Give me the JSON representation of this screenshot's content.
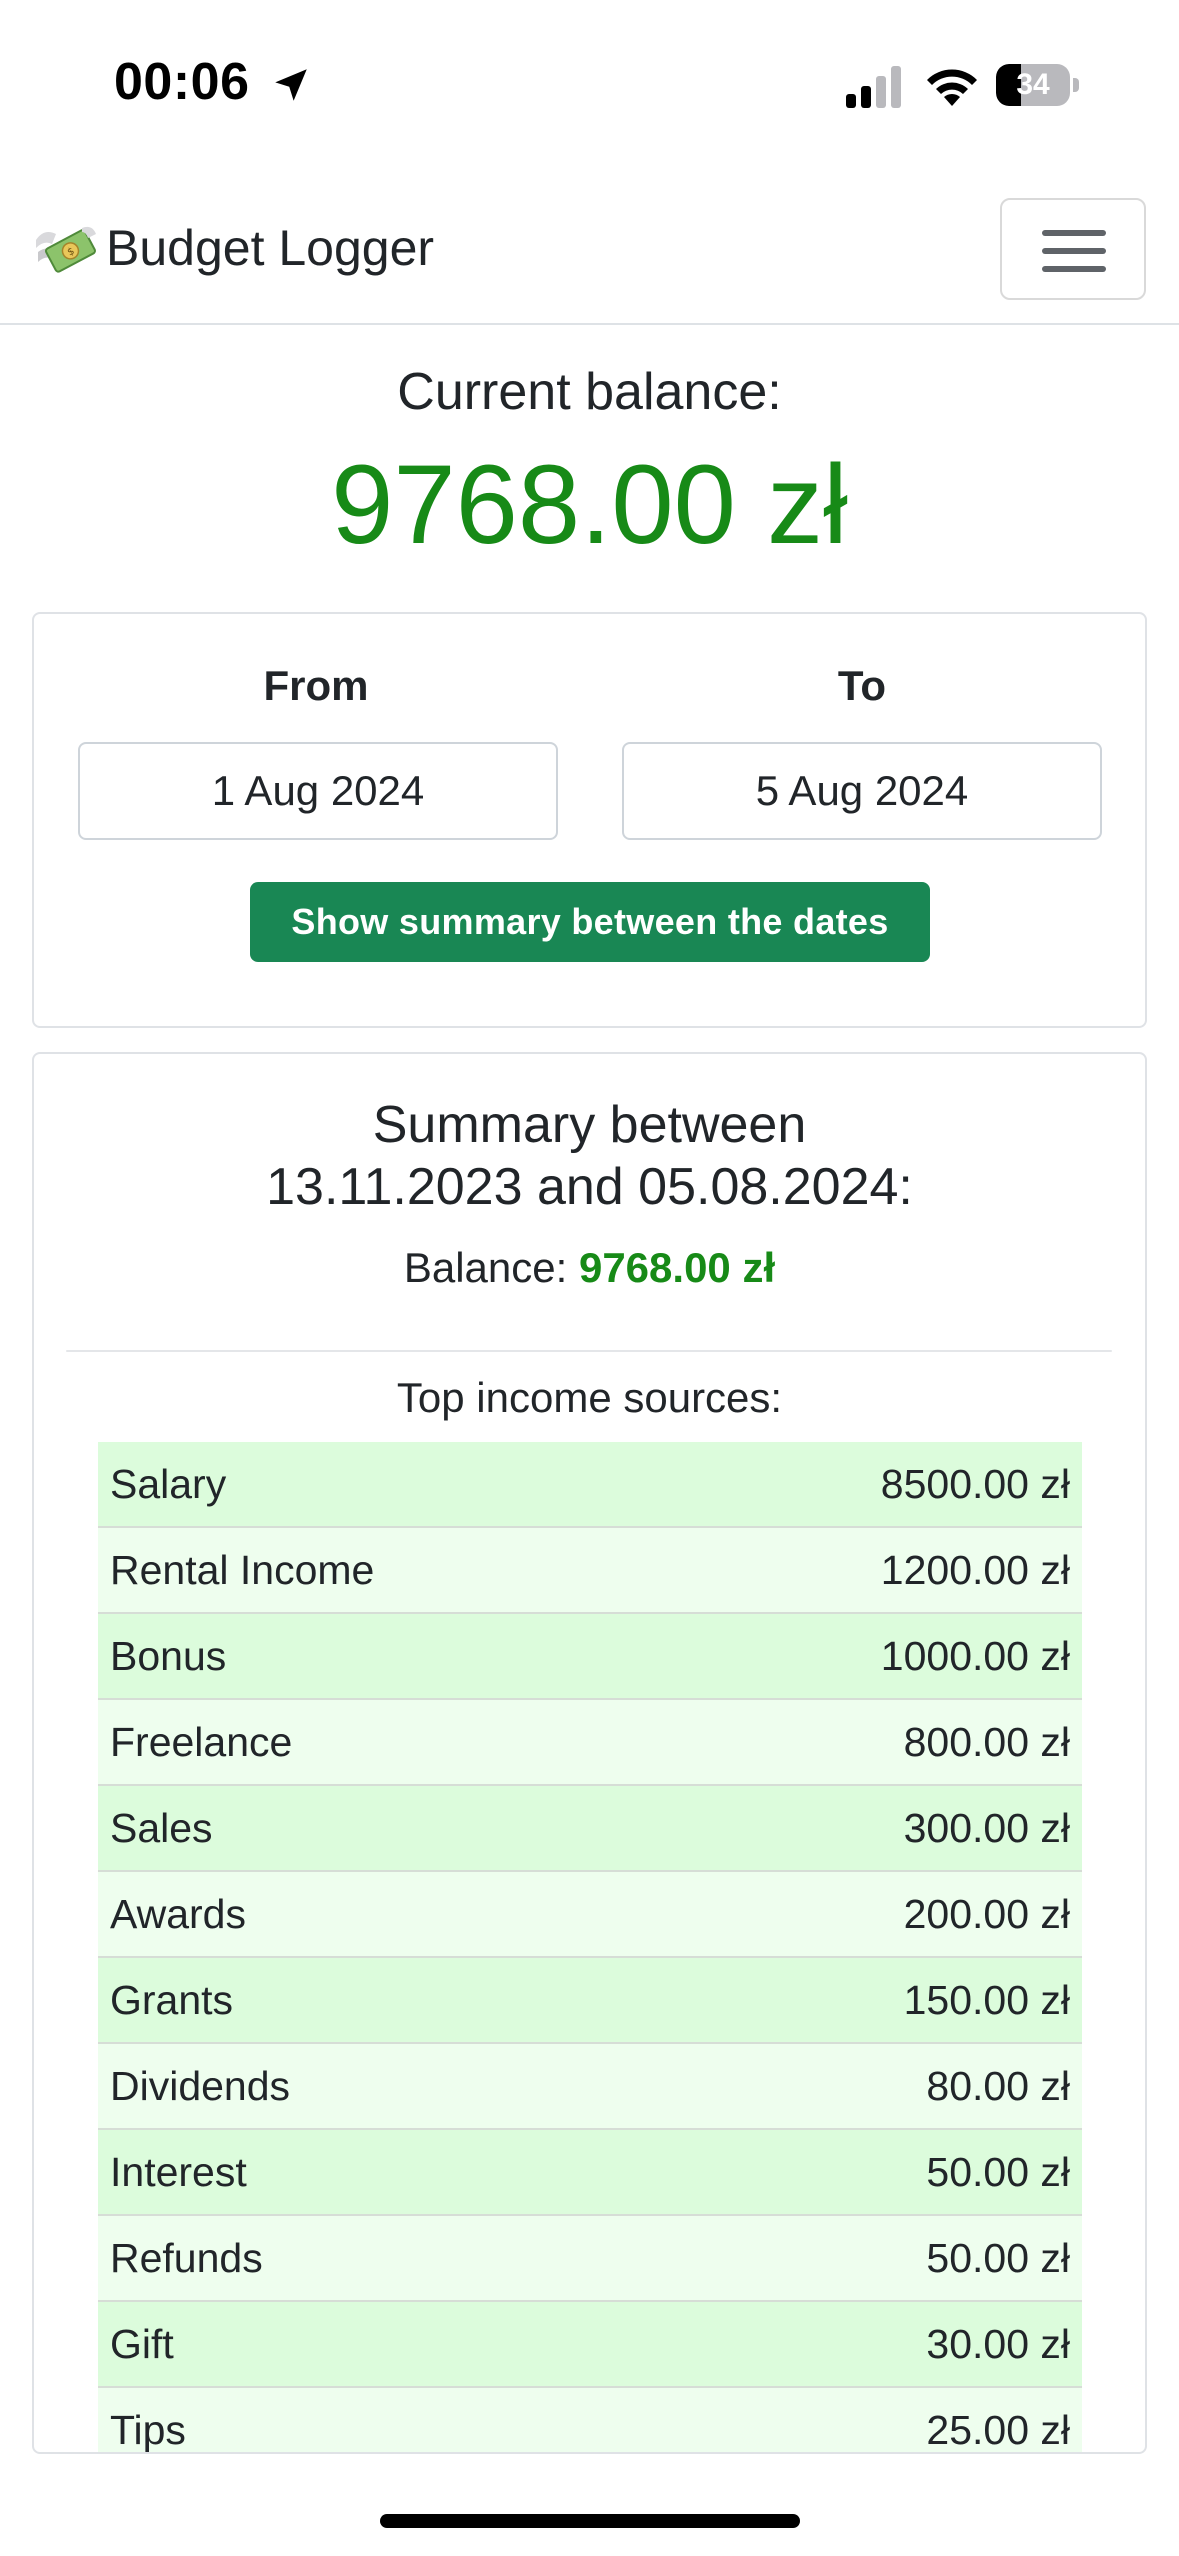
{
  "status_bar": {
    "time": "00:06",
    "battery": "34",
    "battery_level": 0.34
  },
  "navbar": {
    "brand": "Budget Logger",
    "brand_icon": "money-with-wings-icon",
    "menu_icon": "hamburger-menu-icon"
  },
  "balance": {
    "label": "Current balance:",
    "value": "9768.00 zł",
    "color": "#178a17"
  },
  "date_filter": {
    "from_label": "From",
    "from_value": "1 Aug 2024",
    "to_label": "To",
    "to_value": "5 Aug 2024",
    "button_label": "Show summary between the dates",
    "button_color": "#198754"
  },
  "summary": {
    "title_line1": "Summary between",
    "title_line2": "13.11.2023 and 05.08.2024:",
    "balance_label": "Balance:",
    "balance_value": "9768.00 zł",
    "income_title": "Top income sources:",
    "income_rows": [
      {
        "name": "Salary",
        "amount": "8500.00 zł"
      },
      {
        "name": "Rental Income",
        "amount": "1200.00 zł"
      },
      {
        "name": "Bonus",
        "amount": "1000.00 zł"
      },
      {
        "name": "Freelance",
        "amount": "800.00 zł"
      },
      {
        "name": "Sales",
        "amount": "300.00 zł"
      },
      {
        "name": "Awards",
        "amount": "200.00 zł"
      },
      {
        "name": "Grants",
        "amount": "150.00 zł"
      },
      {
        "name": "Dividends",
        "amount": "80.00 zł"
      },
      {
        "name": "Interest",
        "amount": "50.00 zł"
      },
      {
        "name": "Refunds",
        "amount": "50.00 zł"
      },
      {
        "name": "Gift",
        "amount": "30.00 zł"
      },
      {
        "name": "Tips",
        "amount": "25.00 zł"
      }
    ],
    "row_colors": [
      "#dcfcdc",
      "#eefeee"
    ]
  }
}
